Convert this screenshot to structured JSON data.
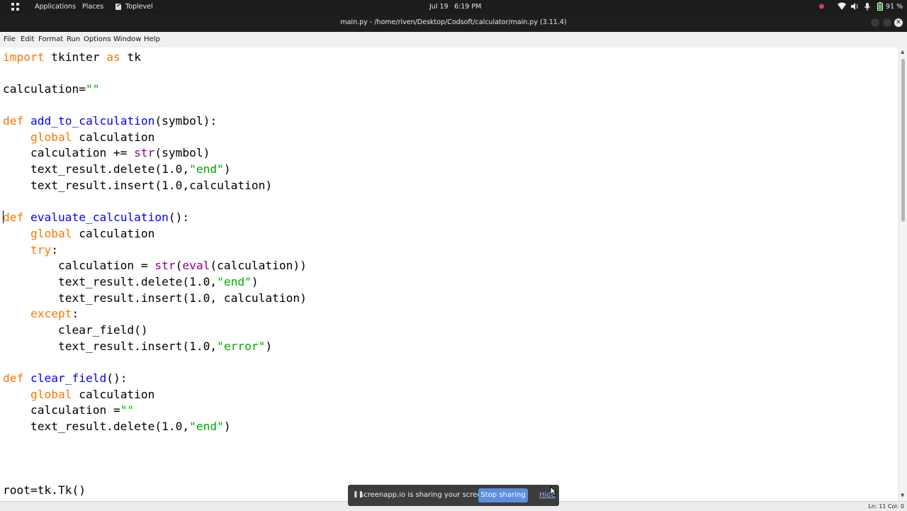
{
  "topbar": {
    "applications": "Applications",
    "places": "Places",
    "active_app": "Toplevel",
    "date": "Jul 19",
    "time": "6:19 PM",
    "battery": "91 %"
  },
  "window": {
    "title": "main.py - /home/riven/Desktop/Codsoft/calculator/main.py (3.11.4)"
  },
  "menu": {
    "items": [
      "File",
      "Edit",
      "Format",
      "Run",
      "Options",
      "Window",
      "Help"
    ]
  },
  "code": {
    "l1": {
      "kw1": "import",
      "t1": " tkinter ",
      "kw2": "as",
      "t2": " tk"
    },
    "l2": {
      "t1": "calculation=",
      "s1": "\"\""
    },
    "l3": {
      "kw1": "def",
      "sp": " ",
      "fn": "add_to_calculation",
      "t1": "(symbol):"
    },
    "l4": {
      "ind": "    ",
      "kw1": "global",
      "t1": " calculation"
    },
    "l5": {
      "t1": "    calculation += ",
      "bi": "str",
      "t2": "(symbol)"
    },
    "l6": {
      "t1": "    text_result.delete(1.0,",
      "s1": "\"end\"",
      "t2": ")"
    },
    "l7": {
      "t1": "    text_result.insert(1.0,calculation)"
    },
    "l8": {
      "kw1": "def",
      "sp": " ",
      "fn": "evaluate_calculation",
      "t1": "():"
    },
    "l9": {
      "ind": "    ",
      "kw1": "global",
      "t1": " calculation"
    },
    "l10": {
      "ind": "    ",
      "kw1": "try",
      "t1": ":"
    },
    "l11": {
      "t1": "        calculation = ",
      "bi1": "str",
      "t2": "(",
      "bi2": "eval",
      "t3": "(calculation))"
    },
    "l12": {
      "t1": "        text_result.delete(1.0,",
      "s1": "\"end\"",
      "t2": ")"
    },
    "l13": {
      "t1": "        text_result.insert(1.0, calculation)"
    },
    "l14": {
      "ind": "    ",
      "kw1": "except",
      "t1": ":"
    },
    "l15": {
      "t1": "        clear_field()"
    },
    "l16": {
      "t1": "        text_result.insert(1.0,",
      "s1": "\"error\"",
      "t2": ")"
    },
    "l17": {
      "kw1": "def",
      "sp": " ",
      "fn": "clear_field",
      "t1": "():"
    },
    "l18": {
      "ind": "    ",
      "kw1": "global",
      "t1": " calculation"
    },
    "l19": {
      "t1": "    calculation =",
      "s1": "\"\""
    },
    "l20": {
      "t1": "    text_result.delete(1.0,",
      "s1": "\"end\"",
      "t2": ")"
    },
    "l21": {
      "t1": "root=tk.Tk()"
    }
  },
  "statusbar": {
    "position": "Ln: 11  Col: 0"
  },
  "share_banner": {
    "message": "screenapp.io is sharing your screen.",
    "stop_label": "Stop sharing",
    "hide_label": "Hide"
  },
  "colors": {
    "keyword": "#ff7700",
    "definition": "#0000ff",
    "builtin": "#900090",
    "string": "#00aa00",
    "stop_button": "#5c8de0"
  },
  "icons": [
    "apps-grid-icon",
    "toplevel-app-icon",
    "record-icon",
    "wifi-icon",
    "volume-icon",
    "microphone-icon",
    "battery-icon",
    "pause-icon",
    "mouse-pointer-icon"
  ]
}
